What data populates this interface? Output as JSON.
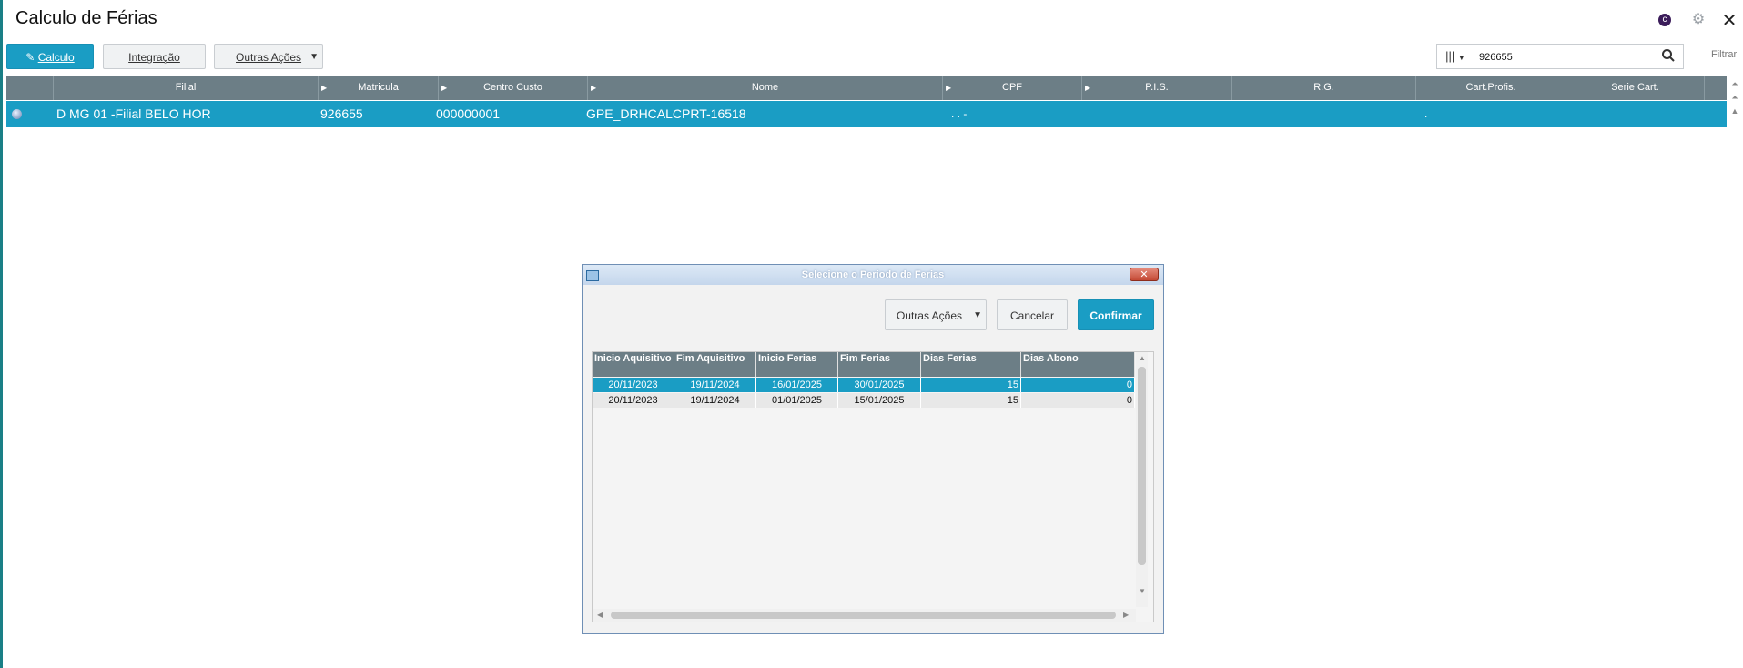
{
  "app": {
    "title": "Calculo de Férias",
    "icons": {
      "totvs": "totvs-logo-icon",
      "settings": "gear-icon",
      "close": "close-icon"
    }
  },
  "toolbar": {
    "calculo_label": "Calculo",
    "calculo_underline": "C",
    "integracao_label": "Integração",
    "outras_acoes_label": "Outras Ações"
  },
  "search": {
    "value": "926655",
    "filter_label": "Filtrar"
  },
  "grid": {
    "headers": [
      "Filial",
      "Matricula",
      "Centro Custo",
      "Nome",
      "CPF",
      "P.I.S.",
      "R.G.",
      "Cart.Profis.",
      "Serie Cart."
    ],
    "row": {
      "filial": "D MG 01 -Filial BELO HOR",
      "matricula": "926655",
      "centro_custo": "000000001",
      "nome": "GPE_DRHCALCPRT-16518",
      "cpf": ". . -",
      "cart_profis": "."
    }
  },
  "dialog": {
    "title": "Selecione o Periodo de Ferias",
    "buttons": {
      "outras_acoes": "Outras Ações",
      "cancelar": "Cancelar",
      "confirmar": "Confirmar"
    },
    "columns": [
      "Inicio Aquisitivo",
      "Fim Aquisitivo",
      "Inicio Ferias",
      "Fim Ferias",
      "Dias Ferias",
      "Dias Abono"
    ],
    "rows": [
      [
        "20/11/2023",
        "19/11/2024",
        "16/01/2025",
        "30/01/2025",
        "15",
        "0"
      ],
      [
        "20/11/2023",
        "19/11/2024",
        "01/01/2025",
        "15/01/2025",
        "15",
        "0"
      ]
    ],
    "selected_row": 0
  },
  "colors": {
    "accent": "#1a9dc4",
    "header": "#6c7e86"
  }
}
